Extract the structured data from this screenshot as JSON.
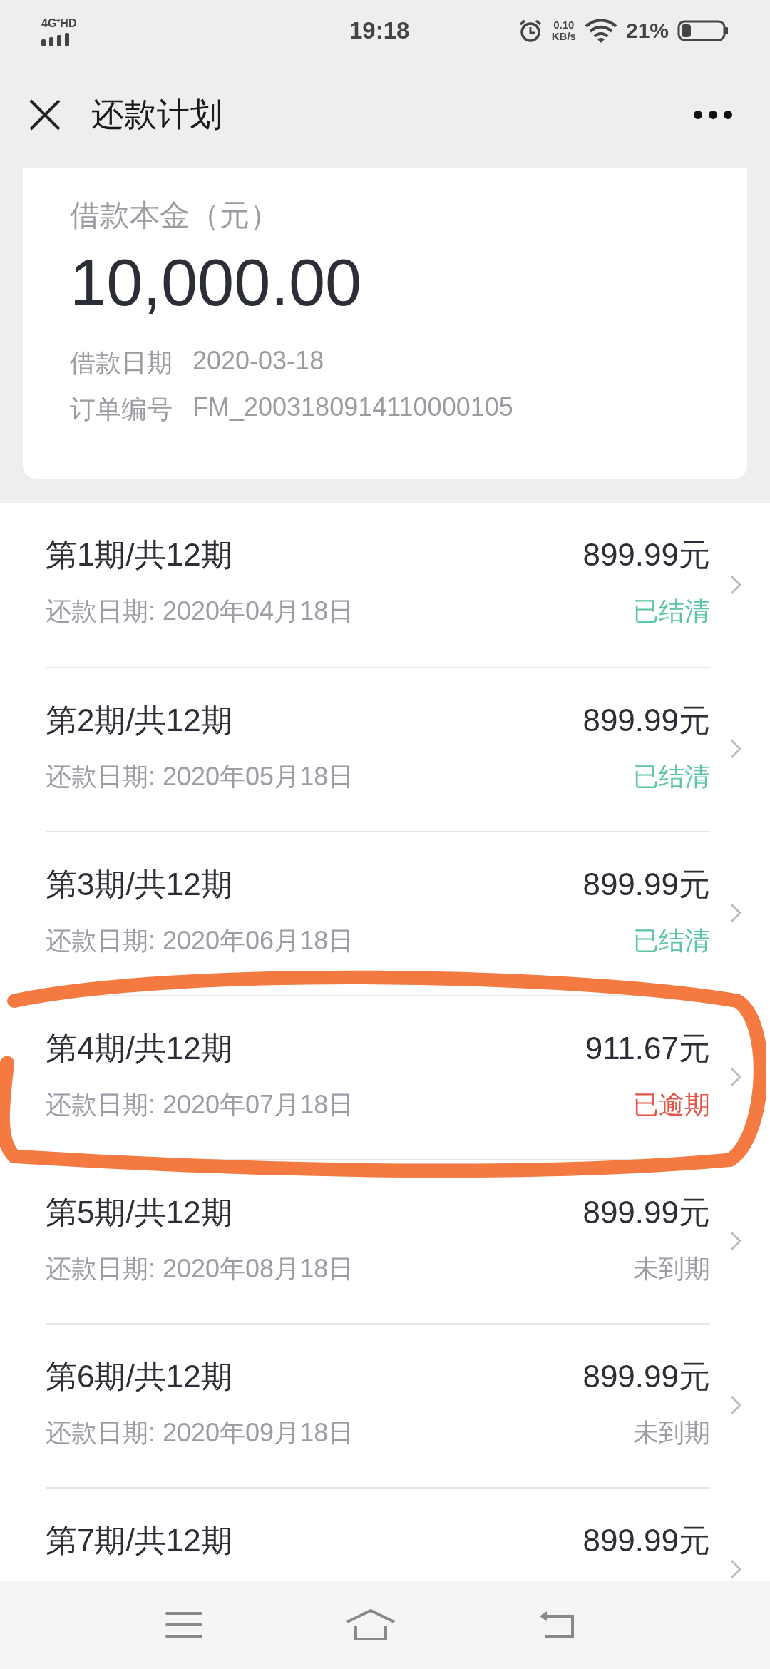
{
  "status_bar": {
    "network": "4G⁺HD",
    "time": "19:18",
    "speed": "0.10",
    "speed_unit": "KB/s",
    "battery": "21%"
  },
  "header": {
    "title": "还款计划"
  },
  "loan": {
    "principal_label": "借款本金（元）",
    "principal": "10,000.00",
    "date_label": "借款日期",
    "date": "2020-03-18",
    "order_label": "订单编号",
    "order": "FM_2003180914110000105"
  },
  "installments": [
    {
      "title": "第1期/共12期",
      "amount": "899.99元",
      "date": "还款日期: 2020年04月18日",
      "status": "已结清",
      "kind": "settled",
      "circled": false
    },
    {
      "title": "第2期/共12期",
      "amount": "899.99元",
      "date": "还款日期: 2020年05月18日",
      "status": "已结清",
      "kind": "settled",
      "circled": false
    },
    {
      "title": "第3期/共12期",
      "amount": "899.99元",
      "date": "还款日期: 2020年06月18日",
      "status": "已结清",
      "kind": "settled",
      "circled": false
    },
    {
      "title": "第4期/共12期",
      "amount": "911.67元",
      "date": "还款日期: 2020年07月18日",
      "status": "已逾期",
      "kind": "overdue",
      "circled": true
    },
    {
      "title": "第5期/共12期",
      "amount": "899.99元",
      "date": "还款日期: 2020年08月18日",
      "status": "未到期",
      "kind": "pending",
      "circled": false
    },
    {
      "title": "第6期/共12期",
      "amount": "899.99元",
      "date": "还款日期: 2020年09月18日",
      "status": "未到期",
      "kind": "pending",
      "circled": false
    },
    {
      "title": "第7期/共12期",
      "amount": "899.99元",
      "circled": false
    }
  ]
}
